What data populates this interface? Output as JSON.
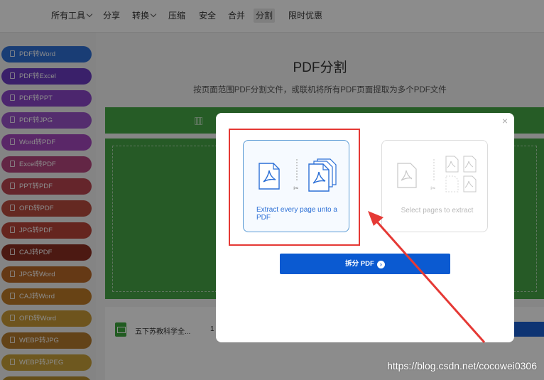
{
  "nav": {
    "items": [
      {
        "label": "所有工具",
        "has_caret": true
      },
      {
        "label": "分享"
      },
      {
        "label": "转换",
        "has_caret": true
      },
      {
        "label": "压缩"
      },
      {
        "label": "安全"
      },
      {
        "label": "合并"
      },
      {
        "label": "分割",
        "active": true
      },
      {
        "label": "限时优惠"
      }
    ]
  },
  "sidebar": {
    "items": [
      {
        "label": "PDF转Word",
        "color": "#2f6fd6"
      },
      {
        "label": "PDF转Excel",
        "color": "#6a3bc1"
      },
      {
        "label": "PDF转PPT",
        "color": "#8a46c8"
      },
      {
        "label": "PDF转JPG",
        "color": "#9a52c8"
      },
      {
        "label": "Word转PDF",
        "color": "#a447bd"
      },
      {
        "label": "Excel转PDF",
        "color": "#b4467e"
      },
      {
        "label": "PPT转PDF",
        "color": "#b8444f"
      },
      {
        "label": "OFD转PDF",
        "color": "#b84c3f"
      },
      {
        "label": "JPG转PDF",
        "color": "#b8443a"
      },
      {
        "label": "CAJ转PDF",
        "color": "#8b2f22"
      },
      {
        "label": "JPG转Word",
        "color": "#b86827"
      },
      {
        "label": "CAJ转Word",
        "color": "#bd7a27"
      },
      {
        "label": "OFD转Word",
        "color": "#c99a36"
      },
      {
        "label": "WEBP转JPG",
        "color": "#b57a2c"
      },
      {
        "label": "WEBP转JPEG",
        "color": "#c9a13a"
      },
      {
        "label": "WEBP转PNG",
        "color": "#b89030"
      }
    ]
  },
  "main": {
    "title": "PDF分割",
    "subtitle": "按页面范围PDF分割文件，或联机将所有PDF页面提取为多个PDF文件",
    "file": {
      "name": "五下苏教科学全...",
      "size": "1"
    }
  },
  "modal": {
    "option1_label": "Extract every page unto a PDF",
    "option2_label": "Select pages to extract",
    "split_button": "拆分 PDF",
    "close_glyph": "×",
    "chevron_glyph": "›"
  },
  "watermark": "https://blog.csdn.net/cocowei0306",
  "colors": {
    "accent_blue": "#0b5ad1",
    "highlight_red": "#e53935",
    "green": "#46a546"
  }
}
